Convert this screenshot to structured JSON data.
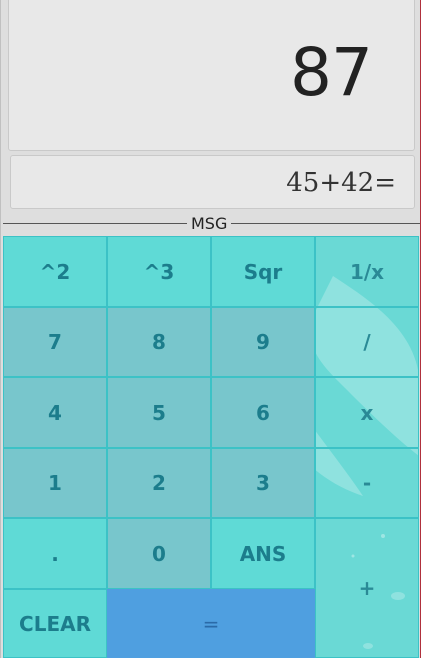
{
  "display": {
    "result": "87",
    "expression": "45+42="
  },
  "message": {
    "label": "MSG"
  },
  "keys": {
    "square": "^2",
    "cube": "^3",
    "sqrt": "Sqr",
    "reciprocal": "1/x",
    "seven": "7",
    "eight": "8",
    "nine": "9",
    "divide": "/",
    "four": "4",
    "five": "5",
    "six": "6",
    "multiply": "x",
    "one": "1",
    "two": "2",
    "three": "3",
    "minus": "-",
    "dot": ".",
    "zero": "0",
    "ans": "ANS",
    "plus": "+",
    "clear": "CLEAR",
    "equals": "="
  },
  "colors": {
    "keypad_accent": "#5fdad6",
    "digit_key": "#78c6cc",
    "equals_key": "#4f9fe0",
    "key_text": "#1c7d8c"
  }
}
